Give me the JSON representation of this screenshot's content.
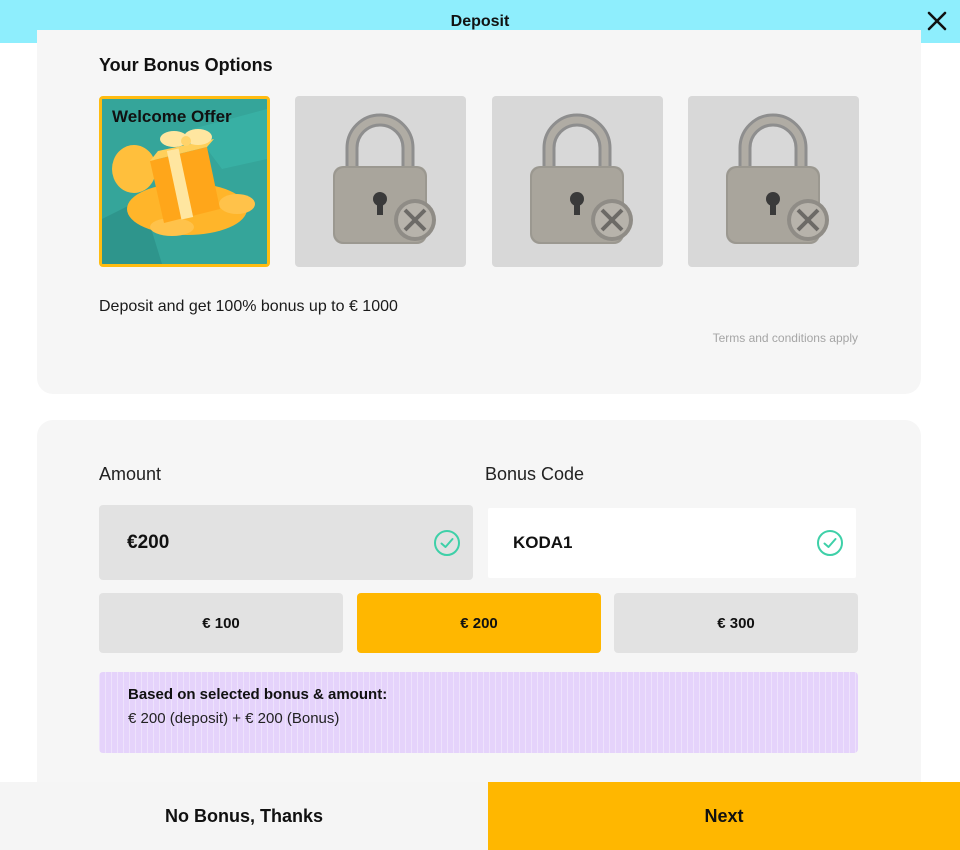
{
  "header": {
    "title": "Deposit",
    "close_icon": "close-icon"
  },
  "bonus": {
    "title": "Your Bonus Options",
    "options": [
      {
        "label": "Welcome Offer",
        "icon": "gift-icon",
        "selected": true,
        "locked": false
      },
      {
        "label": "",
        "icon": "lock-icon",
        "selected": false,
        "locked": true
      },
      {
        "label": "",
        "icon": "lock-icon",
        "selected": false,
        "locked": true
      },
      {
        "label": "",
        "icon": "lock-icon",
        "selected": false,
        "locked": true
      }
    ],
    "description": "Deposit and get 100% bonus up to € 1000",
    "terms": "Terms and conditions apply"
  },
  "amount": {
    "label": "Amount",
    "value": "€200",
    "presets": [
      "€ 100",
      "€ 200",
      "€ 300"
    ],
    "active_preset": "€ 200"
  },
  "bonus_code": {
    "label": "Bonus Code",
    "value": "KODA1"
  },
  "summary": {
    "title": "Based on selected bonus & amount:",
    "line": "€ 200 (deposit) + € 200 (Bonus)"
  },
  "footer": {
    "no_bonus_label": "No Bonus, Thanks",
    "next_label": "Next"
  },
  "colors": {
    "header_bg": "#8eeefd",
    "accent": "#ffb700",
    "summary_bg": "#e5d3fb",
    "check": "#3ed0a8"
  }
}
